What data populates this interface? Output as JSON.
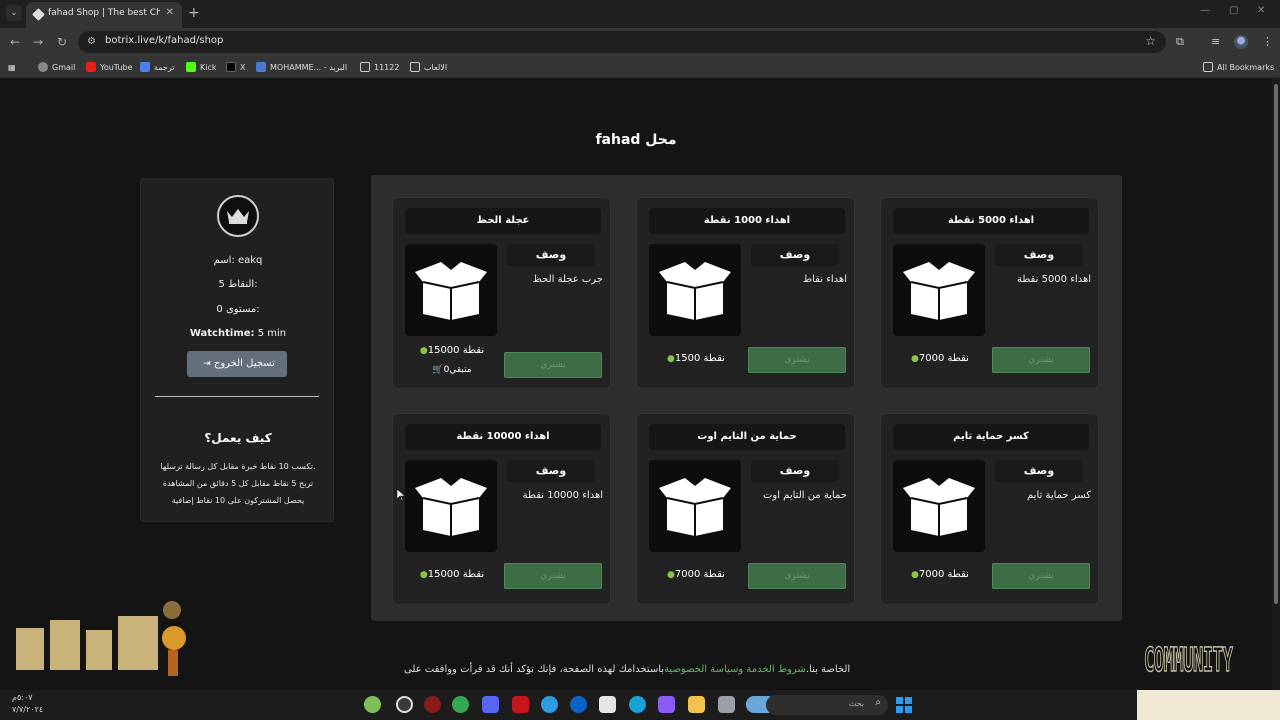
{
  "browser": {
    "tab_title": "fahad Shop | The best ChatBot",
    "url": "botrix.live/k/fahad/shop",
    "bookmarks": [
      "Gmail",
      "YouTube",
      "ترجمة",
      "Kick",
      "X",
      "MOHAMME... - البريد",
      "11122",
      "الالعاب"
    ],
    "all_bookmarks": "All Bookmarks"
  },
  "shop_title": "fahad محل",
  "user": {
    "name": "اسم: eakq",
    "points": "5 النقاط:",
    "level": "0 مستوى:",
    "watchtime_label": "Watchtime:",
    "watchtime_value": "5 min",
    "logout": "تسجيل الخروج"
  },
  "how": {
    "title": "كيف يعمل؟",
    "lines": [
      "تكسب 10 نقاط خبرة مقابل كل رسالة ترسلها.",
      "تربح 5 نقاط مقابل كل 5 دقائق من المشاهدة",
      "يحصل المشتركون على 10 نقاط إضافية"
    ]
  },
  "desc_label": "وصف",
  "buy_label": "يشتري",
  "cards": [
    {
      "title": "اهداء 5000 نقطة",
      "desc": "اهداء 5000 نقطة",
      "price": "7000 نقطة",
      "remaining": ""
    },
    {
      "title": "اهداء 1000 نقطة",
      "desc": "اهداء نقاط",
      "price": "1500 نقطة",
      "remaining": ""
    },
    {
      "title": "عجلة الحظ",
      "desc": "جرب عجلة الحظ",
      "price": "15000 نقطة",
      "remaining": "متبقي0"
    },
    {
      "title": "كسر حماية تايم",
      "desc": "كسر حماية تايم",
      "price": "7000 نقطة",
      "remaining": ""
    },
    {
      "title": "حماية من التايم اوت",
      "desc": "حماية من التايم اوت",
      "price": "7000 نقطة",
      "remaining": ""
    },
    {
      "title": "اهداء 10000 نقطة",
      "desc": "اهداء 10000 نقطة",
      "price": "15000 نقطة",
      "remaining": ""
    }
  ],
  "terms": {
    "prefix": "الخاصة بنا.",
    "link": "شروط الخدمة وسياسة الخصوصية",
    "suffix": "باستخدامك لهذه الصفحة، فإنك تؤكد أنك قد قرأت ووافقت على"
  },
  "taskbar": {
    "time": "٥:٠٧م",
    "date": "٧/٧/٢٠٢٤",
    "search_placeholder": "بحث"
  },
  "overlay": {
    "right_logo_text": "COMMUNITY"
  },
  "colors": {
    "accent_green": "#3e6d45",
    "link_green": "#66b36a",
    "logout_grey": "#63707c"
  }
}
